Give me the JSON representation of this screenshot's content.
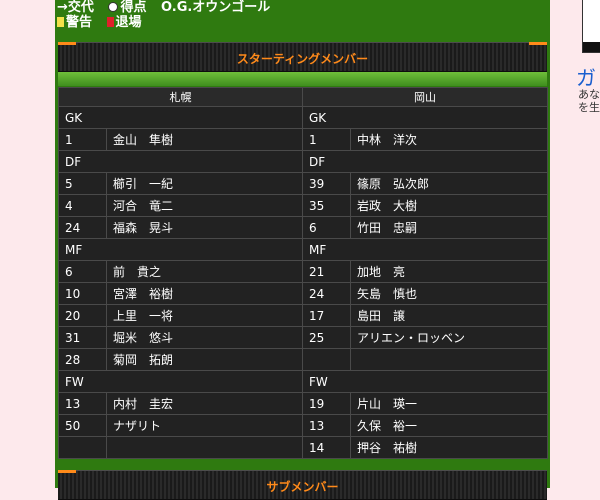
{
  "legend": {
    "sub": "→交代",
    "goal": "得点",
    "own_goal": "O.G.オウンゴール",
    "yellow": "警告",
    "red": "退場"
  },
  "sections": {
    "starting": "スターティングメンバー",
    "subs": "サブメンバー"
  },
  "teams": {
    "home": "札幌",
    "away": "岡山"
  },
  "lineup": [
    {
      "type": "pos",
      "home": "GK",
      "away": "GK"
    },
    {
      "type": "row",
      "hn": "1",
      "hp": "金山　隼樹",
      "an": "1",
      "ap": "中林　洋次"
    },
    {
      "type": "pos",
      "home": "DF",
      "away": "DF"
    },
    {
      "type": "row",
      "hn": "5",
      "hp": "櫛引　一紀",
      "an": "39",
      "ap": "篠原　弘次郎"
    },
    {
      "type": "row",
      "hn": "4",
      "hp": "河合　竜二",
      "an": "35",
      "ap": "岩政　大樹"
    },
    {
      "type": "row",
      "hn": "24",
      "hp": "福森　晃斗",
      "an": "6",
      "ap": "竹田　忠嗣"
    },
    {
      "type": "pos",
      "home": "MF",
      "away": "MF"
    },
    {
      "type": "row",
      "hn": "6",
      "hp": "前　貴之",
      "an": "21",
      "ap": "加地　亮"
    },
    {
      "type": "row",
      "hn": "10",
      "hp": "宮澤　裕樹",
      "an": "24",
      "ap": "矢島　慎也"
    },
    {
      "type": "row",
      "hn": "20",
      "hp": "上里　一将",
      "an": "17",
      "ap": "島田　譲"
    },
    {
      "type": "row",
      "hn": "31",
      "hp": "堀米　悠斗",
      "an": "25",
      "ap": "アリエン・ロッベン"
    },
    {
      "type": "row",
      "hn": "28",
      "hp": "菊岡　拓朗",
      "an": "",
      "ap": ""
    },
    {
      "type": "pos",
      "home": "FW",
      "away": "FW"
    },
    {
      "type": "row",
      "hn": "13",
      "hp": "内村　圭宏",
      "an": "19",
      "ap": "片山　瑛一"
    },
    {
      "type": "row",
      "hn": "50",
      "hp": "ナザリト",
      "an": "13",
      "ap": "久保　裕一"
    },
    {
      "type": "row",
      "hn": "",
      "hp": "",
      "an": "14",
      "ap": "押谷　祐樹"
    }
  ],
  "sidebar": {
    "title": "ガ",
    "line1": "あな",
    "line2": "を生"
  },
  "colors": {
    "accent": "#ff8a1a",
    "field": "#2f7a10",
    "table": "#222222"
  }
}
